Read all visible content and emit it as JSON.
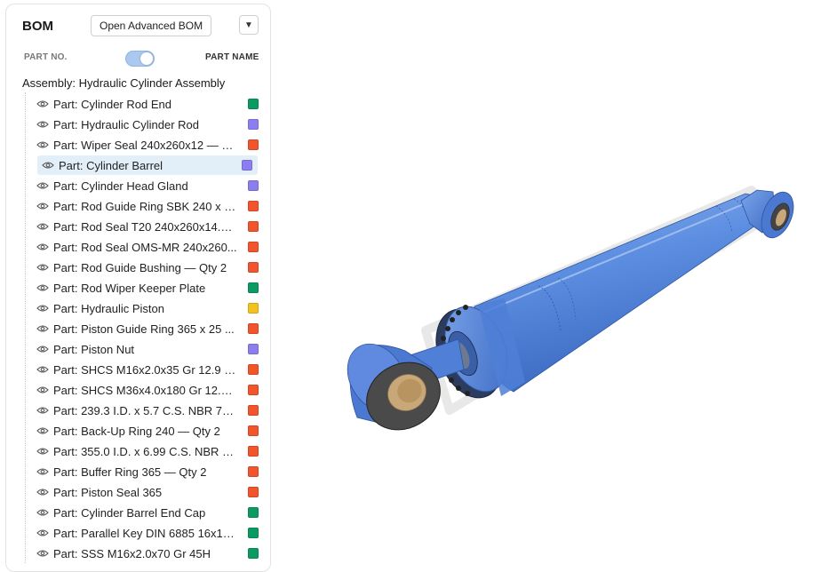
{
  "bom": {
    "title": "BOM",
    "advanced_button": "Open Advanced BOM",
    "dropdown_icon": "caret-down-icon",
    "toggle": {
      "left_label": "PART NO.",
      "right_label": "PART NAME",
      "state": "part-name"
    },
    "assembly_label": "Assembly: Hydraulic Cylinder Assembly",
    "colors": {
      "green": "#0a9b63",
      "purple": "#8b7ff0",
      "orange": "#f2552c",
      "yellow": "#f4c21c"
    },
    "parts": [
      {
        "label": "Part: Cylinder Rod End",
        "color": "#0a9b63"
      },
      {
        "label": "Part: Hydraulic Cylinder Rod",
        "color": "#8b7ff0"
      },
      {
        "label": "Part: Wiper Seal 240x260x12 — Q...",
        "color": "#f2552c"
      },
      {
        "label": "Part: Cylinder Barrel",
        "color": "#8b7ff0",
        "selected": true
      },
      {
        "label": "Part: Cylinder Head Gland",
        "color": "#8b7ff0"
      },
      {
        "label": "Part: Rod Guide Ring SBK 240 x 4...",
        "color": "#f2552c"
      },
      {
        "label": "Part: Rod Seal T20 240x260x14.6 ...",
        "color": "#f2552c"
      },
      {
        "label": "Part: Rod Seal OMS-MR 240x260...",
        "color": "#f2552c"
      },
      {
        "label": "Part: Rod Guide Bushing — Qty 2",
        "color": "#f2552c"
      },
      {
        "label": "Part: Rod Wiper Keeper Plate",
        "color": "#0a9b63"
      },
      {
        "label": "Part: Hydraulic Piston",
        "color": "#f4c21c"
      },
      {
        "label": "Part: Piston Guide Ring 365 x 25 ...",
        "color": "#f2552c"
      },
      {
        "label": "Part: Piston Nut",
        "color": "#8b7ff0"
      },
      {
        "label": "Part: SHCS M16x2.0x35 Gr 12.9 — ...",
        "color": "#f2552c"
      },
      {
        "label": "Part: SHCS M36x4.0x180 Gr 12.9 ...",
        "color": "#f2552c"
      },
      {
        "label": "Part: 239.3 I.D. x 5.7 C.S. NBR 70 S...",
        "color": "#f2552c"
      },
      {
        "label": "Part: Back-Up Ring 240 — Qty 2",
        "color": "#f2552c"
      },
      {
        "label": "Part: 355.0 I.D. x 6.99 C.S. NBR 70 ...",
        "color": "#f2552c"
      },
      {
        "label": "Part: Buffer Ring 365 — Qty 2",
        "color": "#f2552c"
      },
      {
        "label": "Part: Piston Seal 365",
        "color": "#f2552c"
      },
      {
        "label": "Part: Cylinder Barrel End Cap",
        "color": "#0a9b63"
      },
      {
        "label": "Part: Parallel Key DIN 6885 16x10x...",
        "color": "#0a9b63"
      },
      {
        "label": "Part: SSS M16x2.0x70 Gr 45H",
        "color": "#0a9b63"
      }
    ]
  },
  "viewport": {
    "model_name": "hydraulic-cylinder-model",
    "body_color": "#5b8de0",
    "bushing_color": "#c8a878"
  }
}
